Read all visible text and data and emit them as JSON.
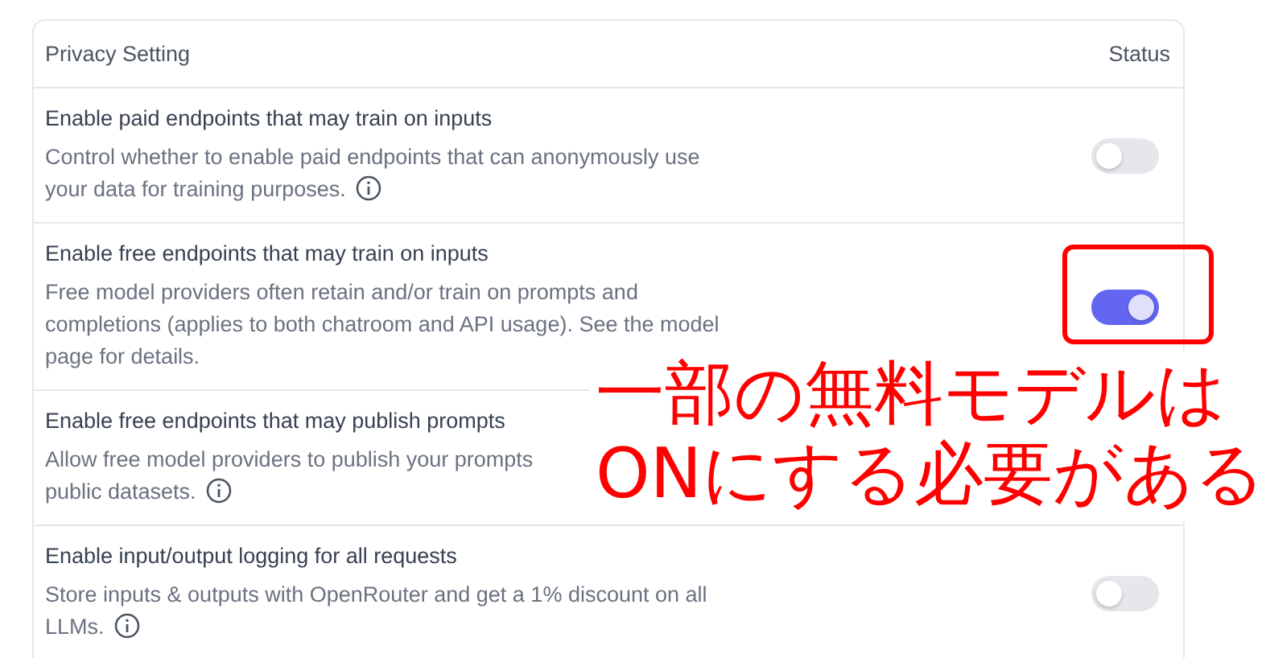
{
  "table": {
    "columns": [
      "Privacy Setting",
      "Status"
    ],
    "rows": [
      {
        "title": "Enable paid endpoints that may train on inputs",
        "lines": [
          "Control whether to enable paid endpoints that can anonymously use",
          "your data for training purposes."
        ],
        "info": true,
        "on": false
      },
      {
        "title": "Enable free endpoints that may train on inputs",
        "lines": [
          "Free model providers often retain and/or train on prompts and",
          "completions (applies to both chatroom and API usage). See the model",
          "page for details."
        ],
        "info": false,
        "on": true
      },
      {
        "title": "Enable free endpoints that may publish prompts",
        "lines": [
          "Allow free model providers to publish your prompts",
          "public datasets."
        ],
        "info": true
      },
      {
        "title": "Enable input/output logging for all requests",
        "lines": [
          "Store inputs & outputs with OpenRouter and get a 1% discount on all",
          "LLMs."
        ],
        "info": true,
        "on": false
      }
    ]
  },
  "annotation": {
    "lines": [
      "一部の無料モデルは",
      "ONにする必要がある"
    ]
  }
}
